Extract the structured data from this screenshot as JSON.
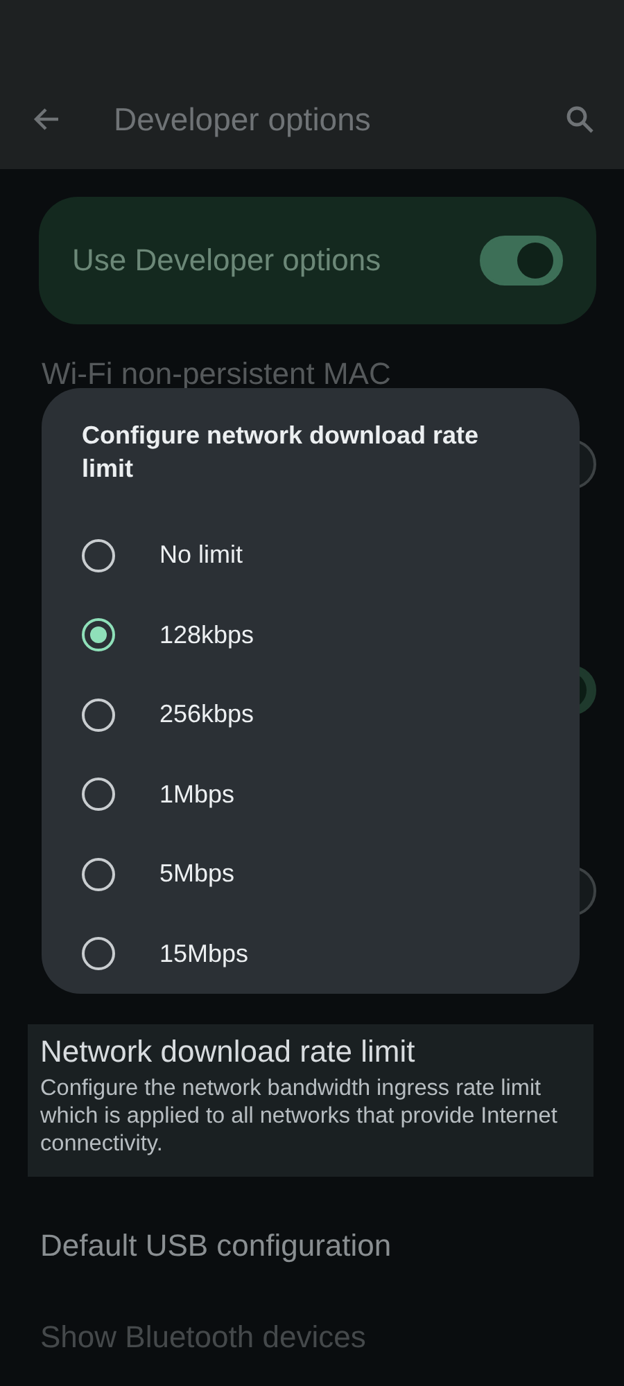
{
  "app_bar": {
    "title": "Developer options"
  },
  "master_switch": {
    "label": "Use Developer options",
    "on": true
  },
  "background_settings": {
    "title": "Wi-Fi non-persistent MAC",
    "toggles": [
      {
        "on": false
      },
      {
        "on": true
      },
      {
        "on": false
      }
    ]
  },
  "dialog": {
    "title": "Configure network download rate limit",
    "options": [
      {
        "label": "No limit",
        "selected": false
      },
      {
        "label": "128kbps",
        "selected": true
      },
      {
        "label": "256kbps",
        "selected": false
      },
      {
        "label": "1Mbps",
        "selected": false
      },
      {
        "label": "5Mbps",
        "selected": false
      },
      {
        "label": "15Mbps",
        "selected": false
      }
    ]
  },
  "settings": [
    {
      "title": "Network download rate limit",
      "summary": "Configure the network bandwidth ingress rate limit which is applied to all networks that provide Internet connectivity.",
      "highlighted": true
    },
    {
      "title": "Default USB configuration",
      "highlighted": false,
      "faded": false
    },
    {
      "title": "Show Bluetooth devices",
      "highlighted": false,
      "faded": true
    }
  ]
}
